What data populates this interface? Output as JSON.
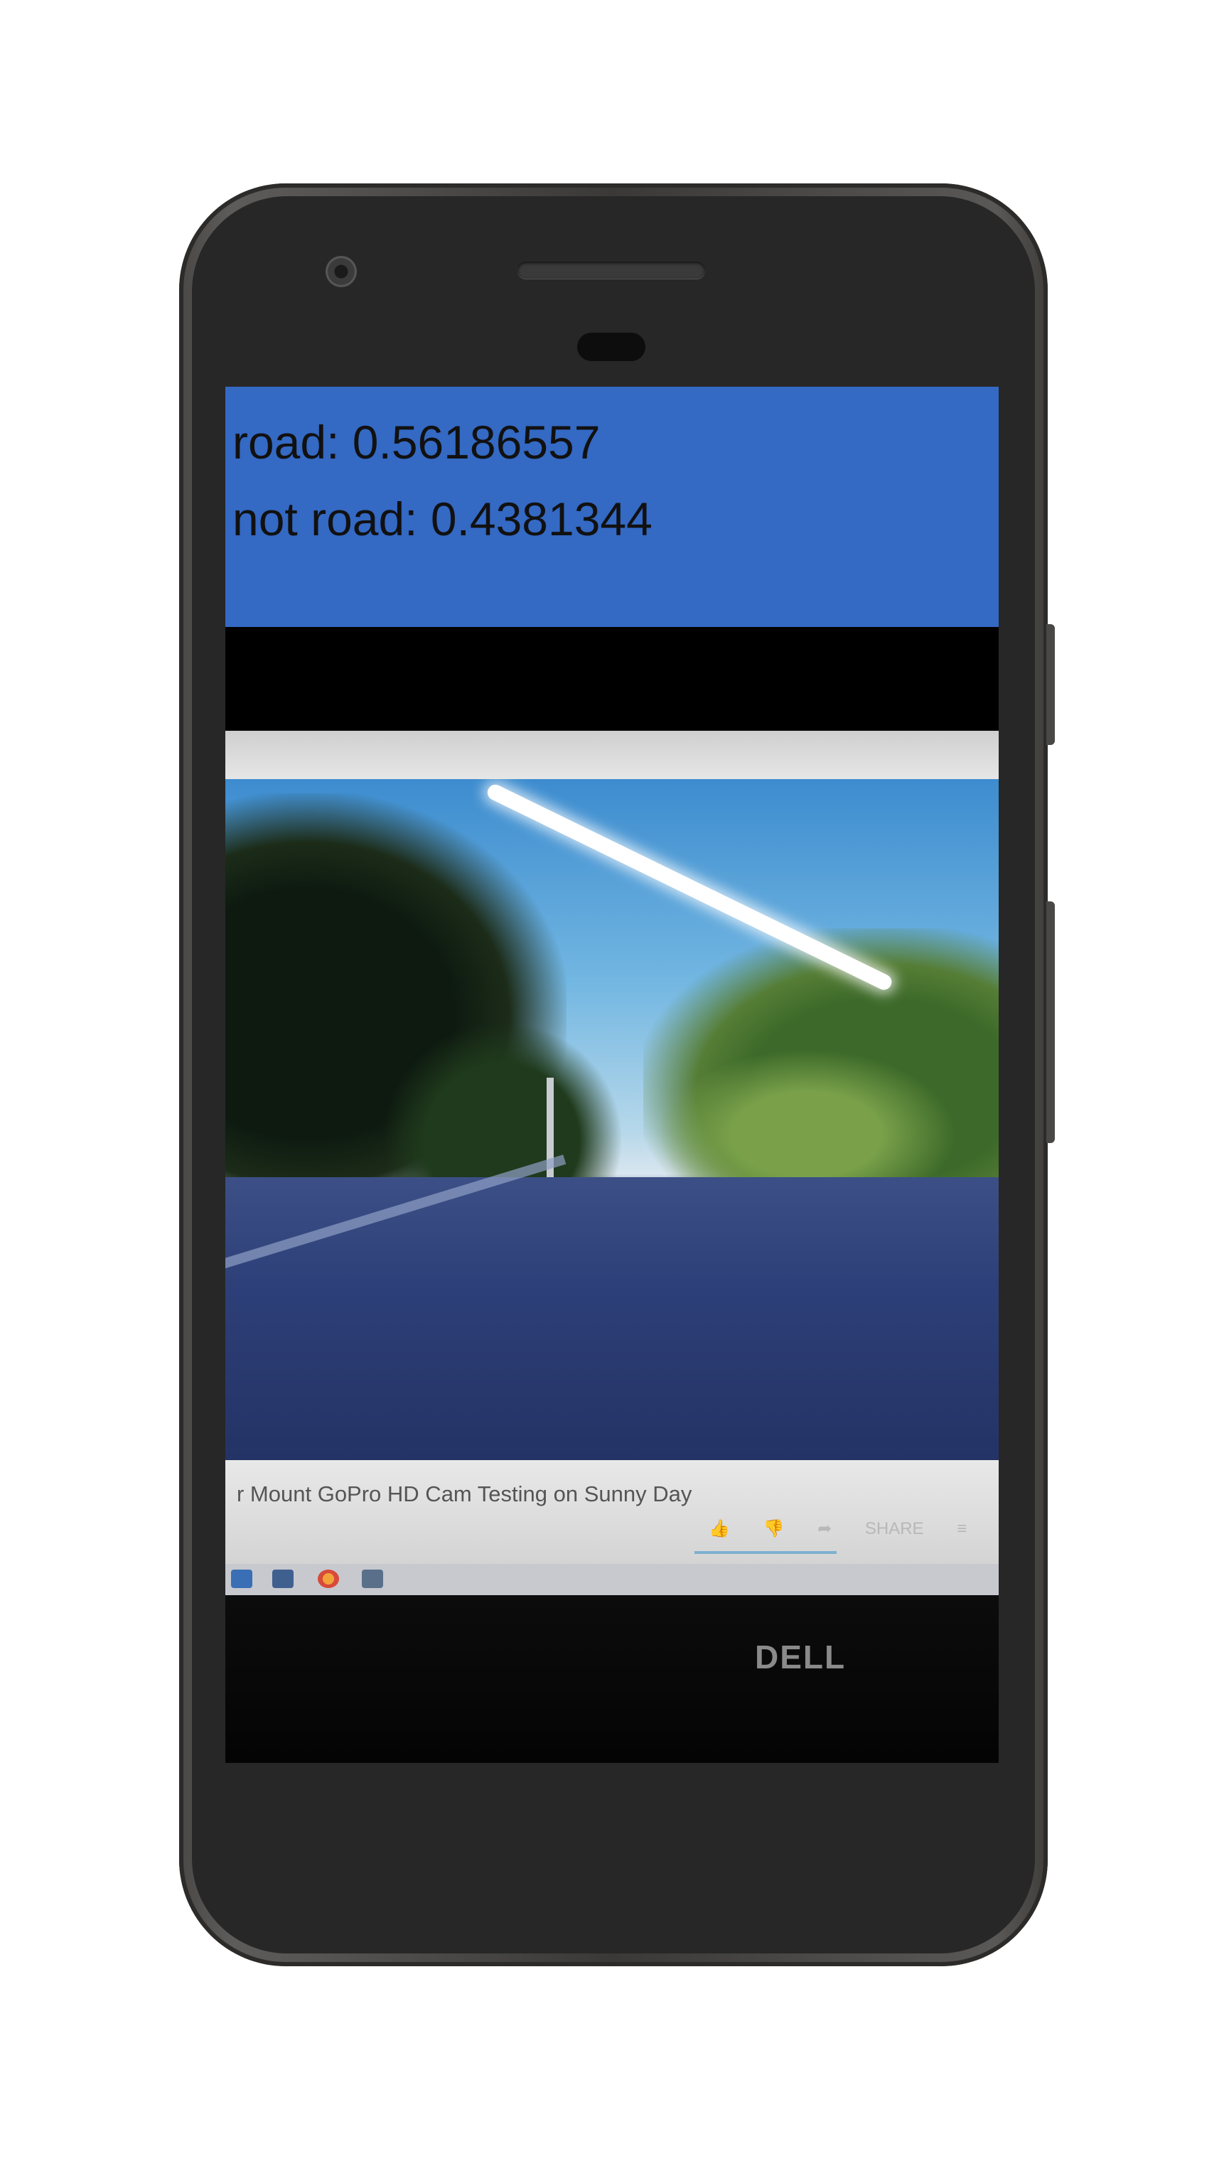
{
  "classification": {
    "road_line": "road: 0.56186557",
    "not_road_line": "not road: 0.4381344"
  },
  "camera_preview": {
    "video_title": "r Mount GoPro HD Cam Testing on Sunny Day",
    "actions": "👍 👎 ➦ SHARE ≡",
    "monitor_brand": "DELL"
  },
  "colors": {
    "result_panel": "#3469c4",
    "screen_background": "#000000",
    "phone_body": "#272727"
  }
}
